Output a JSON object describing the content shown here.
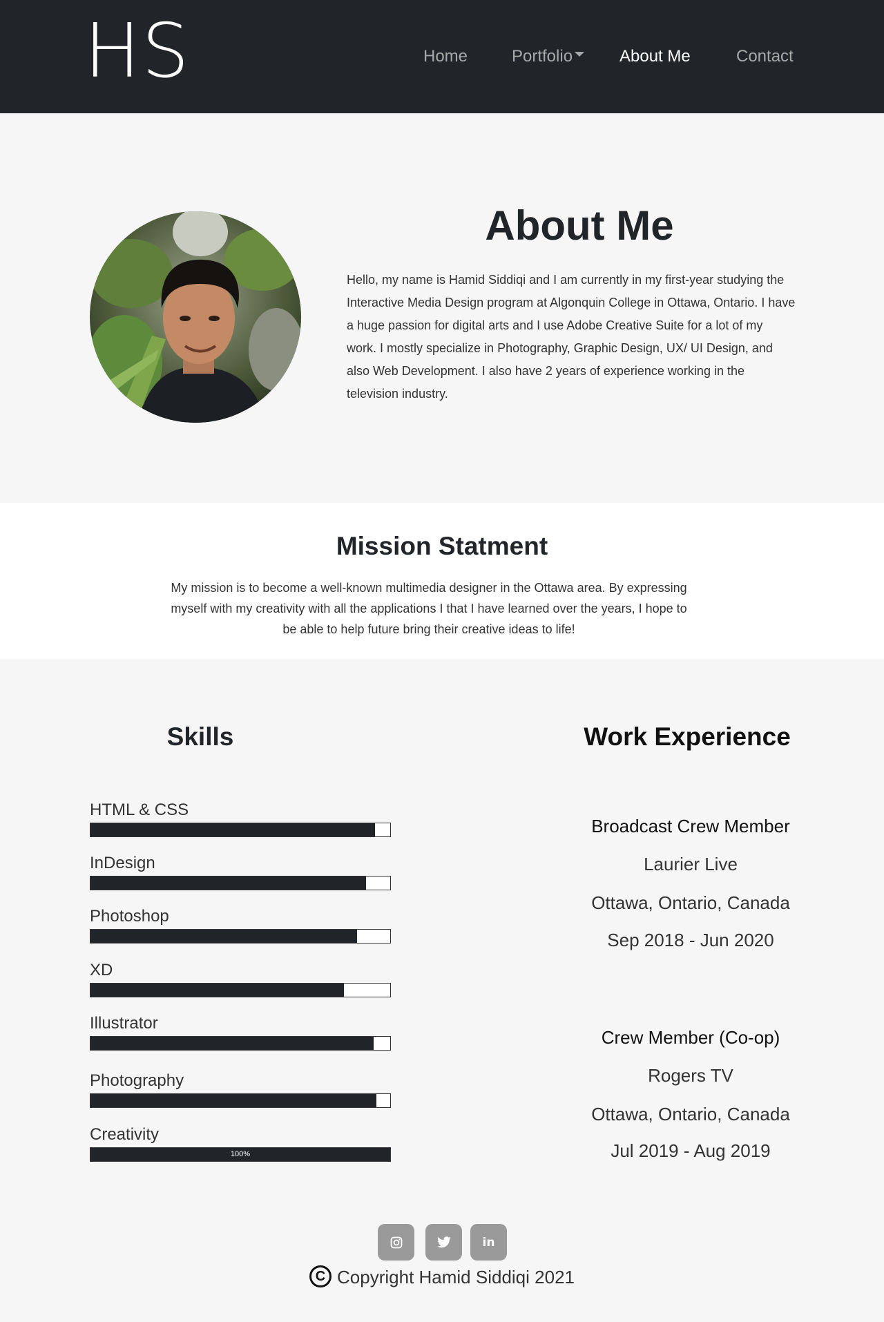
{
  "nav": {
    "logo": "HS",
    "links": [
      {
        "label": "Home"
      },
      {
        "label": "Portfolio"
      },
      {
        "label": "About Me"
      },
      {
        "label": "Contact"
      }
    ],
    "active": "About Me"
  },
  "about": {
    "title": "About Me",
    "text": "Hello, my name is Hamid Siddiqi and I am currently in my first-year studying the Interactive Media Design program at Algonquin College in Ottawa, Ontario. I have a huge passion for digital arts and I use Adobe Creative Suite for a lot of my work. I mostly specialize in Photography, Graphic Design, UX/ UI Design, and also Web Development. I also have 2 years of experience working in the television industry."
  },
  "mission": {
    "title": "Mission Statment",
    "text": "My mission is to become a well-known multimedia designer in the Ottawa area. By expressing myself with my creativity with all the applications I that I have learned over the years, I hope to be able to help future bring their creative ideas to life!"
  },
  "skills": {
    "title": "Skills",
    "items": [
      {
        "label": "HTML & CSS",
        "level": 0.95
      },
      {
        "label": "InDesign",
        "level": 0.92
      },
      {
        "label": "Photoshop",
        "level": 0.89
      },
      {
        "label": "XD",
        "level": 0.845
      },
      {
        "label": "Illustrator",
        "level": 0.945
      },
      {
        "label": "Photography",
        "level": 0.955
      },
      {
        "label": "Creativity",
        "level": 1.0,
        "level_text": "100%"
      }
    ]
  },
  "work": {
    "title": "Work Experience",
    "jobs": [
      {
        "role": "Broadcast Crew Member",
        "company": "Laurier Live",
        "location": "Ottawa, Ontario, Canada",
        "dates": "Sep 2018 - Jun 2020"
      },
      {
        "role": "Crew Member (Co-op)",
        "company": "Rogers TV",
        "location": "Ottawa, Ontario, Canada",
        "dates": "Jul 2019 - Aug 2019"
      }
    ]
  },
  "footer": {
    "social": [
      {
        "icon": "instagram-icon"
      },
      {
        "icon": "twitter-icon"
      },
      {
        "icon": "linkedin-icon",
        "glyph": "in"
      }
    ],
    "copyright_symbol": "C",
    "copyright": "Copyright Hamid Siddiqi 2021"
  },
  "colors": {
    "navbar": "#212529",
    "bar_fill": "#212529",
    "social_bg": "#9a9a9a",
    "page_bg": "#f6f6f6"
  }
}
